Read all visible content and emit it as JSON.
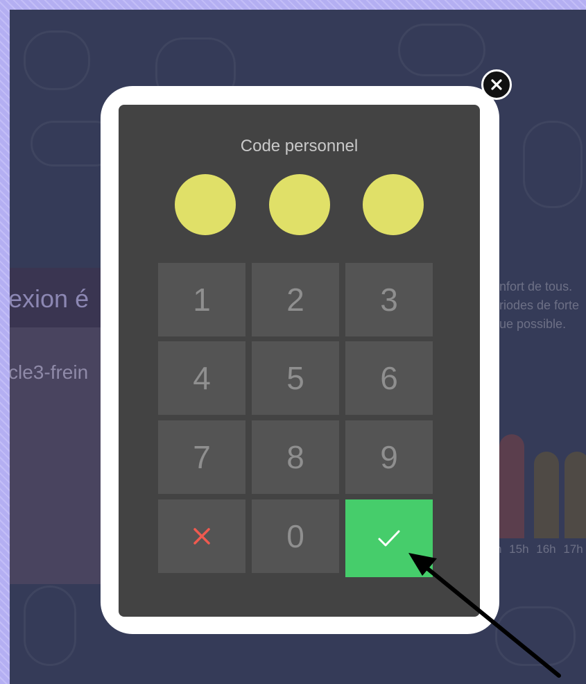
{
  "background": {
    "title_fragment": "exion é",
    "subtitle_fragment": "cle3-frein",
    "text_lines": [
      "nfort de tous.",
      "riodes de forte",
      "ue possible."
    ],
    "hours": "h 15h 16h 17h"
  },
  "keypad": {
    "title": "Code personnel",
    "entered_digits": 3,
    "keys": [
      "1",
      "2",
      "3",
      "4",
      "5",
      "6",
      "7",
      "8",
      "9",
      "✕",
      "0",
      "✓"
    ],
    "cancel_icon": "x-icon",
    "confirm_icon": "check-icon",
    "close_icon": "close-icon"
  },
  "colors": {
    "dot": "#e0e068",
    "confirm": "#46cd6b",
    "cancel": "#f05a4f",
    "key": "#545454",
    "pad": "#434343"
  }
}
